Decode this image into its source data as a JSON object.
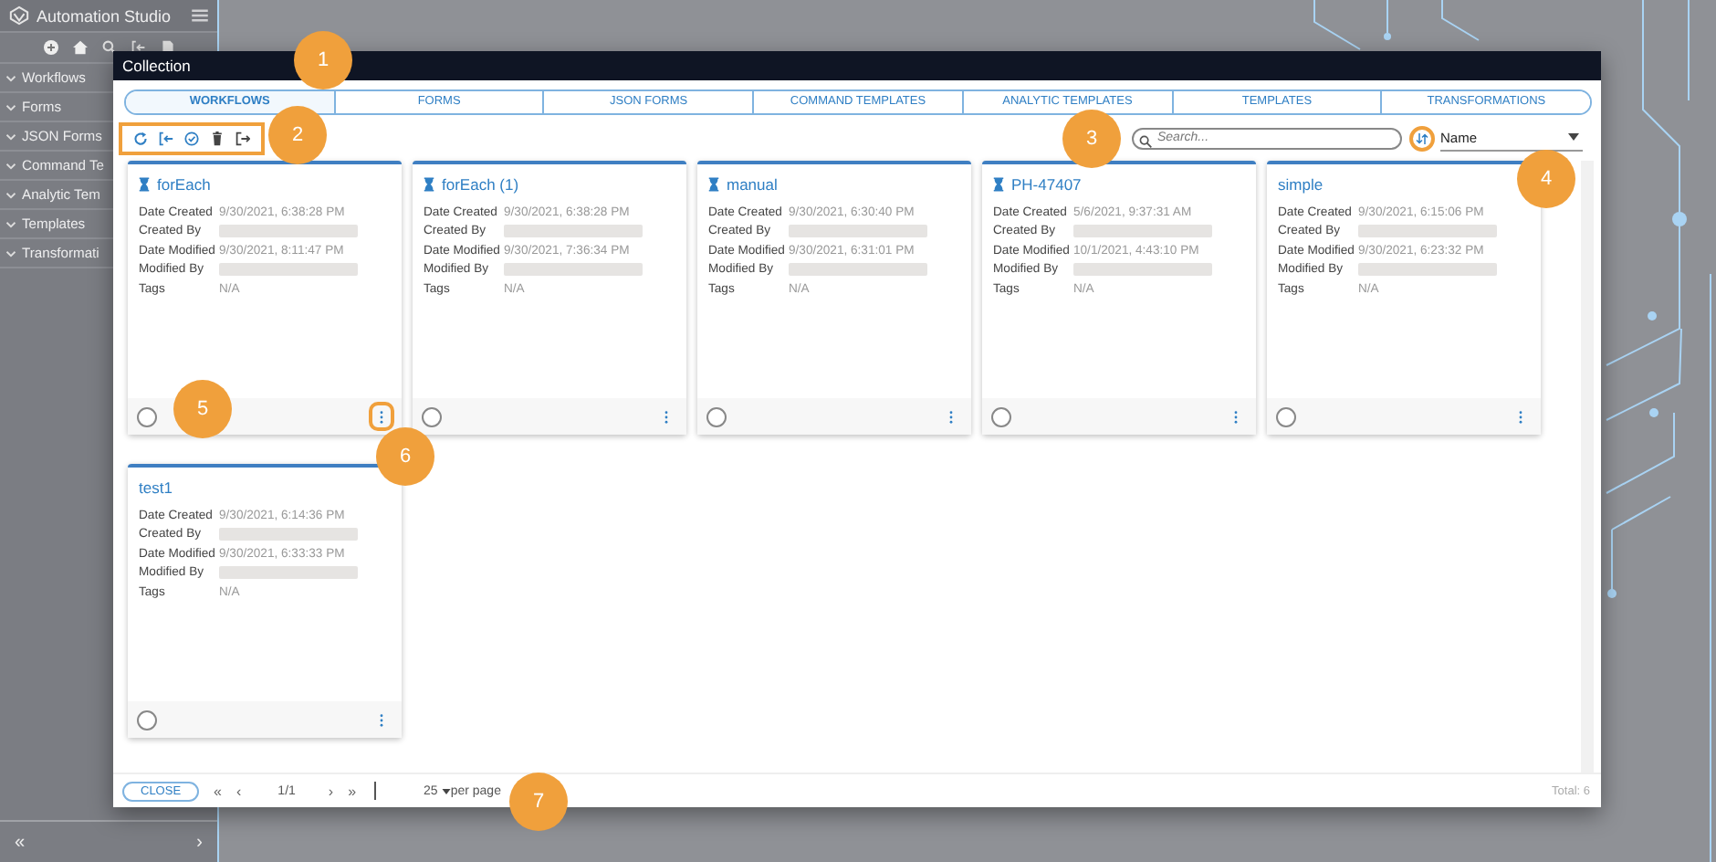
{
  "sidebar": {
    "title": "Automation Studio",
    "items": [
      {
        "label": "Workflows"
      },
      {
        "label": "Forms"
      },
      {
        "label": "JSON Forms"
      },
      {
        "label": "Command Te"
      },
      {
        "label": "Analytic Tem"
      },
      {
        "label": "Templates"
      },
      {
        "label": "Transformati"
      }
    ],
    "collapse": "«",
    "expand": "›"
  },
  "modal": {
    "title": "Collection",
    "tabs": [
      {
        "label": "WORKFLOWS",
        "selected": true
      },
      {
        "label": "FORMS",
        "selected": false
      },
      {
        "label": "JSON FORMS",
        "selected": false
      },
      {
        "label": "COMMAND TEMPLATES",
        "selected": false
      },
      {
        "label": "ANALYTIC TEMPLATES",
        "selected": false
      },
      {
        "label": "TEMPLATES",
        "selected": false
      },
      {
        "label": "TRANSFORMATIONS",
        "selected": false
      }
    ],
    "toolbar": {
      "highlighted": true
    },
    "search": {
      "placeholder": "Search..."
    },
    "sort": {
      "highlighted": true,
      "field": "Name"
    },
    "cards": [
      {
        "title": "forEach",
        "hourglass": true,
        "selected": false,
        "menu_highlighted": true,
        "fields": [
          {
            "label": "Date Created",
            "value": "9/30/2021, 6:38:28 PM"
          },
          {
            "label": "Created By",
            "redacted": true
          },
          {
            "label": "Date Modified",
            "value": "9/30/2021, 8:11:47 PM"
          },
          {
            "label": "Modified By",
            "redacted": true
          },
          {
            "label": "Tags",
            "value": "N/A"
          }
        ]
      },
      {
        "title": "forEach (1)",
        "hourglass": true,
        "selected": false,
        "menu_highlighted": false,
        "fields": [
          {
            "label": "Date Created",
            "value": "9/30/2021, 6:38:28 PM"
          },
          {
            "label": "Created By",
            "redacted": true
          },
          {
            "label": "Date Modified",
            "value": "9/30/2021, 7:36:34 PM"
          },
          {
            "label": "Modified By",
            "redacted": true
          },
          {
            "label": "Tags",
            "value": "N/A"
          }
        ]
      },
      {
        "title": "manual",
        "hourglass": true,
        "selected": false,
        "menu_highlighted": false,
        "fields": [
          {
            "label": "Date Created",
            "value": "9/30/2021, 6:30:40 PM"
          },
          {
            "label": "Created By",
            "redacted": true
          },
          {
            "label": "Date Modified",
            "value": "9/30/2021, 6:31:01 PM"
          },
          {
            "label": "Modified By",
            "redacted": true
          },
          {
            "label": "Tags",
            "value": "N/A"
          }
        ]
      },
      {
        "title": "PH-47407",
        "hourglass": true,
        "selected": false,
        "menu_highlighted": false,
        "fields": [
          {
            "label": "Date Created",
            "value": "5/6/2021, 9:37:31 AM"
          },
          {
            "label": "Created By",
            "redacted": true
          },
          {
            "label": "Date Modified",
            "value": "10/1/2021, 4:43:10 PM"
          },
          {
            "label": "Modified By",
            "redacted": true
          },
          {
            "label": "Tags",
            "value": "N/A"
          }
        ]
      },
      {
        "title": "simple",
        "hourglass": false,
        "selected": false,
        "menu_highlighted": false,
        "fields": [
          {
            "label": "Date Created",
            "value": "9/30/2021, 6:15:06 PM"
          },
          {
            "label": "Created By",
            "redacted": true
          },
          {
            "label": "Date Modified",
            "value": "9/30/2021, 6:23:32 PM"
          },
          {
            "label": "Modified By",
            "redacted": true
          },
          {
            "label": "Tags",
            "value": "N/A"
          }
        ]
      },
      {
        "title": "test1",
        "hourglass": false,
        "selected": false,
        "menu_highlighted": false,
        "fields": [
          {
            "label": "Date Created",
            "value": "9/30/2021, 6:14:36 PM"
          },
          {
            "label": "Created By",
            "redacted": true
          },
          {
            "label": "Date Modified",
            "value": "9/30/2021, 6:33:33 PM"
          },
          {
            "label": "Modified By",
            "redacted": true
          },
          {
            "label": "Tags",
            "value": "N/A"
          }
        ]
      }
    ],
    "footer": {
      "close": "CLOSE",
      "first": "«",
      "prev": "‹",
      "page": "1/1",
      "next": "›",
      "last": "»",
      "per_page_value": "25",
      "per_page_label": "per page",
      "total": "Total: 6"
    }
  },
  "callouts": [
    "1",
    "2",
    "3",
    "4",
    "5",
    "6",
    "7"
  ]
}
